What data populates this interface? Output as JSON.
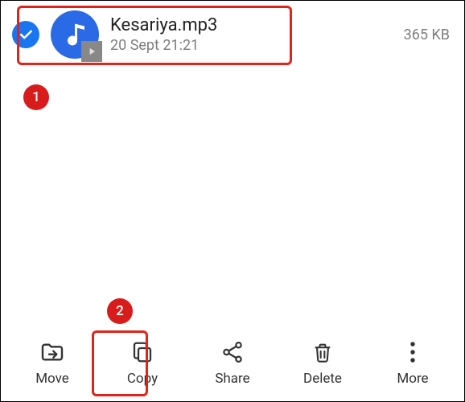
{
  "file": {
    "name": "Kesariya.mp3",
    "date": "20 Sept 21:21",
    "size": "365 KB"
  },
  "actions": {
    "move": "Move",
    "copy": "Copy",
    "share": "Share",
    "delete": "Delete",
    "more": "More"
  },
  "callouts": {
    "one": "1",
    "two": "2"
  }
}
